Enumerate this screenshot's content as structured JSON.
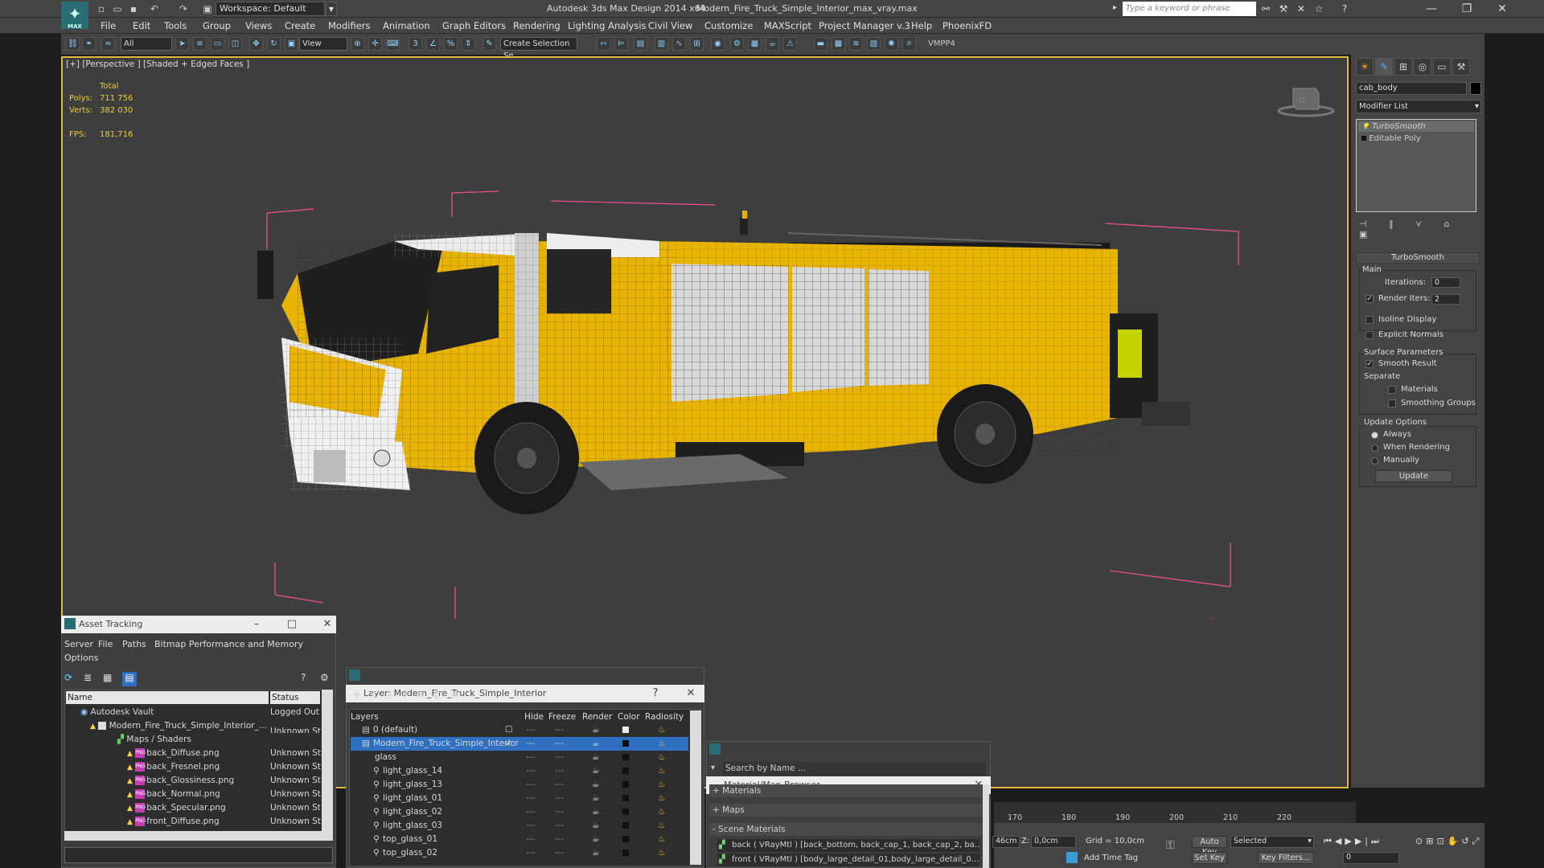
{
  "app": {
    "logo_text": "MAX",
    "workspace": "Workspace: Default",
    "title": "Autodesk 3ds Max Design 2014 x64",
    "file": "Modern_Fire_Truck_Simple_Interior_max_vray.max",
    "search_placeholder": "Type a keyword or phrase"
  },
  "menu": [
    "File",
    "Edit",
    "Tools",
    "Group",
    "Views",
    "Create",
    "Modifiers",
    "Animation",
    "Graph Editors",
    "Rendering",
    "Lighting Analysis",
    "Civil View",
    "Customize",
    "MAXScript",
    "Project Manager v.3",
    "Help",
    "PhoenixFD"
  ],
  "toolbar": {
    "filter": "All",
    "refcoord": "View",
    "selection_set_placeholder": "Create Selection Se",
    "vmpp": "VMPP4"
  },
  "viewport": {
    "label": "[+] [Perspective ] [Shaded + Edged Faces ]",
    "stats": {
      "total_label": "Total",
      "polys_label": "Polys:",
      "polys": "711 756",
      "verts_label": "Verts:",
      "verts": "382 030",
      "fps_label": "FPS:",
      "fps": "181,716"
    }
  },
  "command_panel": {
    "object_name": "cab_body",
    "modifier_list": "Modifier List",
    "stack": [
      "TurboSmooth",
      "Editable Poly"
    ],
    "rollout_title": "TurboSmooth",
    "main_label": "Main",
    "iterations_label": "Iterations:",
    "iterations": "0",
    "render_iters_label": "Render Iters:",
    "render_iters": "2",
    "isoline": "Isoline Display",
    "explicit_normals": "Explicit Normals",
    "surface_params": "Surface Parameters",
    "smooth_result": "Smooth Result",
    "separate": "Separate",
    "materials": "Materials",
    "smoothing_groups": "Smoothing Groups",
    "update_options": "Update Options",
    "always": "Always",
    "when_rendering": "When Rendering",
    "manually": "Manually",
    "update_button": "Update"
  },
  "asset_tracking": {
    "title": "Asset Tracking",
    "menu": [
      "Server",
      "File",
      "Paths",
      "Bitmap Performance and Memory"
    ],
    "menu2": "Options",
    "col_name": "Name",
    "col_status": "Status",
    "rows": [
      {
        "name": "Autodesk Vault",
        "status": "Logged Out"
      },
      {
        "name": "Modern_Fire_Truck_Simple_Interior_...",
        "status": "Unknown St"
      },
      {
        "name": "Maps / Shaders",
        "status": ""
      },
      {
        "name": "back_Diffuse.png",
        "status": "Unknown St"
      },
      {
        "name": "back_Fresnel.png",
        "status": "Unknown St"
      },
      {
        "name": "back_Glossiness.png",
        "status": "Unknown St"
      },
      {
        "name": "back_Normal.png",
        "status": "Unknown St"
      },
      {
        "name": "back_Specular.png",
        "status": "Unknown St"
      },
      {
        "name": "front_Diffuse.png",
        "status": "Unknown St"
      }
    ]
  },
  "layers": {
    "title": "Layer: Modern_Fire_Truck_Simple_Interior",
    "cols": [
      "Layers",
      "Hide",
      "Freeze",
      "Render",
      "Color",
      "Radiosity"
    ],
    "rows": [
      "0 (default)",
      "Modern_Fire_Truck_Simple_Interior",
      "glass",
      "light_glass_14",
      "light_glass_13",
      "light_glass_01",
      "light_glass_02",
      "light_glass_03",
      "top_glass_01",
      "top_glass_02"
    ]
  },
  "material_browser": {
    "title": "Material/Map Browser",
    "search": "Search by Name ...",
    "sections": [
      "+ Materials",
      "+ Maps",
      "- Scene Materials"
    ],
    "items": [
      "back ( VRayMtl ) [back_bottom, back_cap_1, back_cap_2, ba...",
      "front ( VRayMtl ) [body_large_detail_01,body_large_detail_0..."
    ]
  },
  "timeline": {
    "ticks": [
      "170",
      "180",
      "190",
      "200",
      "210",
      "220"
    ]
  },
  "status": {
    "grid": "Grid = 10,0cm",
    "z_label": "Z:",
    "z_value": "0,0cm",
    "coord_partial": "46cm",
    "auto_key": "Auto Key",
    "selected": "Selected",
    "set_key": "Set Key",
    "key_filters": "Key Filters...",
    "add_time_tag": "Add Time Tag",
    "frame": "0"
  },
  "colors": {
    "truck_yellow": "#e8b400",
    "viewport_bg": "#3e3e3e",
    "selection_border": "#e0b83a",
    "bbox": "#e8508a"
  }
}
